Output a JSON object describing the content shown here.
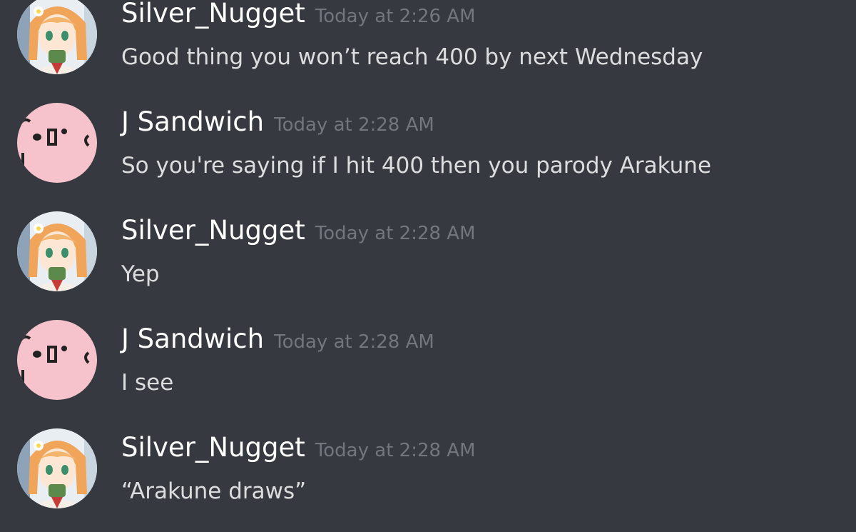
{
  "messages": [
    {
      "username": "Silver_Nugget",
      "timestamp": "Today at 2:26 AM",
      "content": "Good thing you won’t reach 400 by next Wednesday",
      "avatar": "anime-girl-avatar"
    },
    {
      "username": "J Sandwich",
      "timestamp": "Today at 2:28 AM",
      "content": "So you're saying if I hit 400 then you parody Arakune",
      "avatar": "pink-blob-avatar"
    },
    {
      "username": "Silver_Nugget",
      "timestamp": "Today at 2:28 AM",
      "content": "Yep",
      "avatar": "anime-girl-avatar"
    },
    {
      "username": "J Sandwich",
      "timestamp": "Today at 2:28 AM",
      "content": "I see",
      "avatar": "pink-blob-avatar"
    },
    {
      "username": "Silver_Nugget",
      "timestamp": "Today at 2:28 AM",
      "content": "“Arakune draws”",
      "avatar": "anime-girl-avatar"
    }
  ],
  "colors": {
    "background": "#36393f",
    "username": "#ffffff",
    "timestamp": "#72767d",
    "message_text": "#dcddde"
  }
}
